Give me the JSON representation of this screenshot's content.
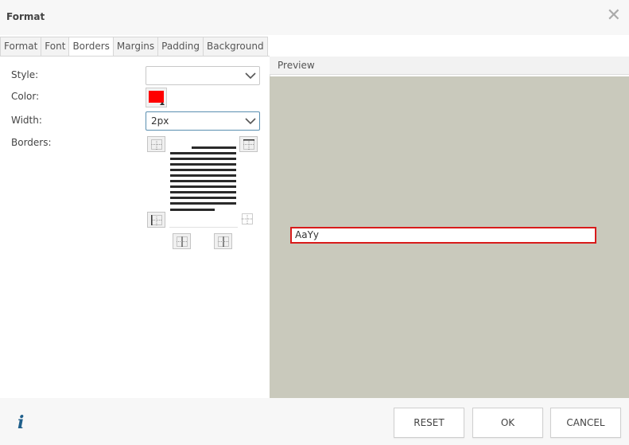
{
  "dialog": {
    "title": "Format"
  },
  "tabs": [
    {
      "label": "Format",
      "active": false
    },
    {
      "label": "Font",
      "active": false
    },
    {
      "label": "Borders",
      "active": true
    },
    {
      "label": "Margins",
      "active": false
    },
    {
      "label": "Padding",
      "active": false
    },
    {
      "label": "Background",
      "active": false
    }
  ],
  "form": {
    "style_label": "Style:",
    "style_value": "",
    "color_label": "Color:",
    "color_value": "#ff0000",
    "width_label": "Width:",
    "width_value": "2px",
    "borders_label": "Borders:"
  },
  "preview": {
    "header": "Preview",
    "sample_text": "AaYy",
    "background": "#c9c9bc",
    "border_color": "#d81b1b"
  },
  "footer": {
    "info_icon": "i",
    "reset_label": "RESET",
    "ok_label": "OK",
    "cancel_label": "CANCEL"
  }
}
